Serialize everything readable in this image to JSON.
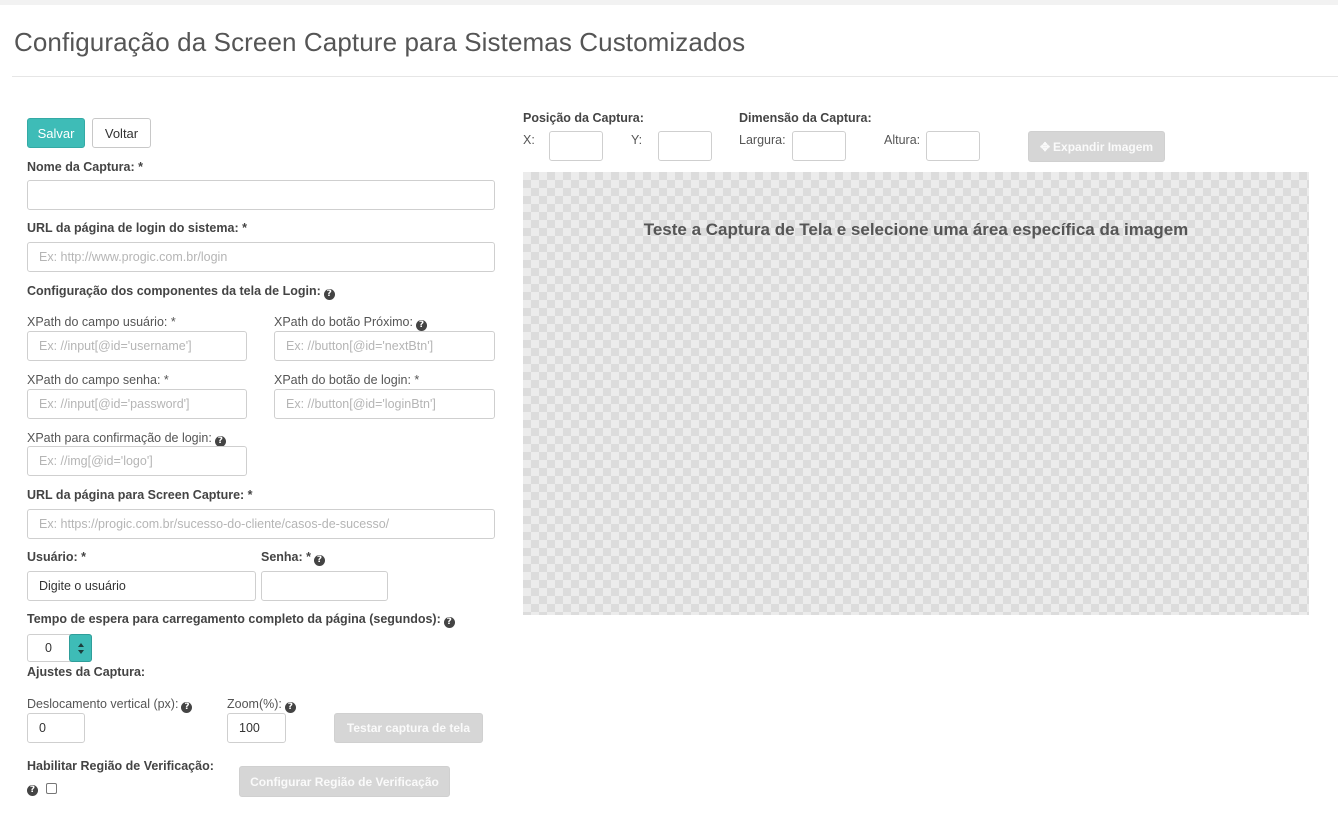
{
  "page": {
    "title": "Configuração da Screen Capture para Sistemas Customizados"
  },
  "toolbar": {
    "save_label": "Salvar",
    "back_label": "Voltar"
  },
  "form": {
    "capture_name": {
      "label": "Nome da Captura: *",
      "value": ""
    },
    "login_url": {
      "label": "URL da página de login do sistema: *",
      "placeholder": "Ex: http://www.progic.com.br/login"
    },
    "login_components_label": "Configuração dos componentes da tela de Login:",
    "xpath_user": {
      "label": "XPath do campo usuário: *",
      "placeholder": "Ex: //input[@id='username']"
    },
    "xpath_next": {
      "label": "XPath do botão Próximo:",
      "placeholder": "Ex: //button[@id='nextBtn']"
    },
    "xpath_password": {
      "label": "XPath do campo senha: *",
      "placeholder": "Ex: //input[@id='password']"
    },
    "xpath_login_btn": {
      "label": "XPath do botão de login: *",
      "placeholder": "Ex: //button[@id='loginBtn']"
    },
    "xpath_confirm": {
      "label": "XPath para confirmação de login:",
      "placeholder": "Ex: //img[@id='logo']"
    },
    "capture_url": {
      "label": "URL da página para Screen Capture: *",
      "placeholder": "Ex: https://progic.com.br/sucesso-do-cliente/casos-de-sucesso/"
    },
    "user": {
      "label": "Usuário: *",
      "value": "Digite o usuário"
    },
    "password": {
      "label": "Senha: *",
      "value": ""
    },
    "wait_time": {
      "label": "Tempo de espera para carregamento completo da página (segundos):",
      "value": "0"
    },
    "adjust_label": "Ajustes da Captura:",
    "vertical_offset": {
      "label": "Deslocamento vertical (px):",
      "value": "0"
    },
    "zoom": {
      "label": "Zoom(%):",
      "value": "100"
    },
    "test_button": "Testar captura de tela",
    "verification_label": "Habilitar Região de Verificação:",
    "verification_checked": false,
    "configure_region_button": "Configurar Região de Verificação"
  },
  "capture": {
    "position_label": "Posição da Captura:",
    "x_label": "X:",
    "y_label": "Y:",
    "x_value": "",
    "y_value": "",
    "dimension_label": "Dimensão da Captura:",
    "width_label": "Largura:",
    "height_label": "Altura:",
    "width_value": "",
    "height_value": "",
    "expand_button": "Expandir Imagem",
    "preview_message": "Teste a Captura de Tela e selecione uma área específica da imagem"
  },
  "icons": {
    "help": "question-circle-icon",
    "expand": "expand-arrows-icon"
  },
  "colors": {
    "primary": "#3ebcb7",
    "disabled": "#d6d6d6"
  }
}
